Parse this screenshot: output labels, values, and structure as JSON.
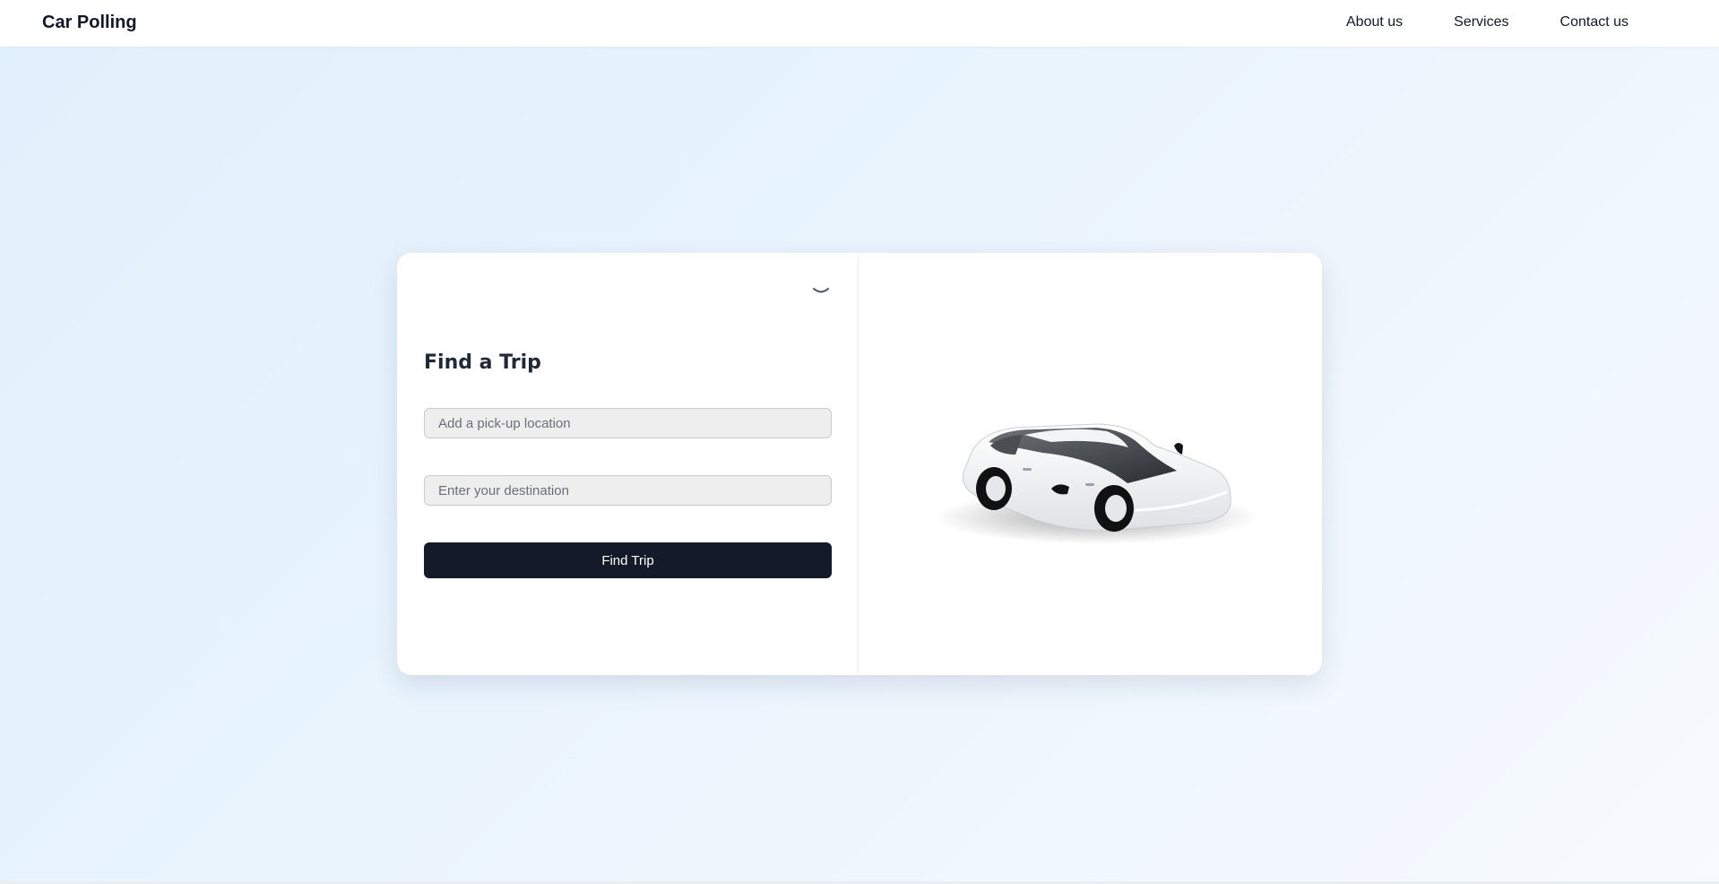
{
  "header": {
    "brand": "Car Polling",
    "nav": {
      "about": "About us",
      "services": "Services",
      "contact": "Contact us"
    }
  },
  "trip_form": {
    "title": "Find a Trip",
    "pickup_placeholder": "Add a pick-up location",
    "destination_placeholder": "Enter your destination",
    "submit_label": "Find Trip",
    "collapse_icon": "chevron-down-icon"
  },
  "illustration": {
    "icon": "car-illustration"
  },
  "colors": {
    "button_bg": "#141a2a",
    "input_bg": "#eeeeee",
    "page_bg": "#e0f0fc"
  }
}
